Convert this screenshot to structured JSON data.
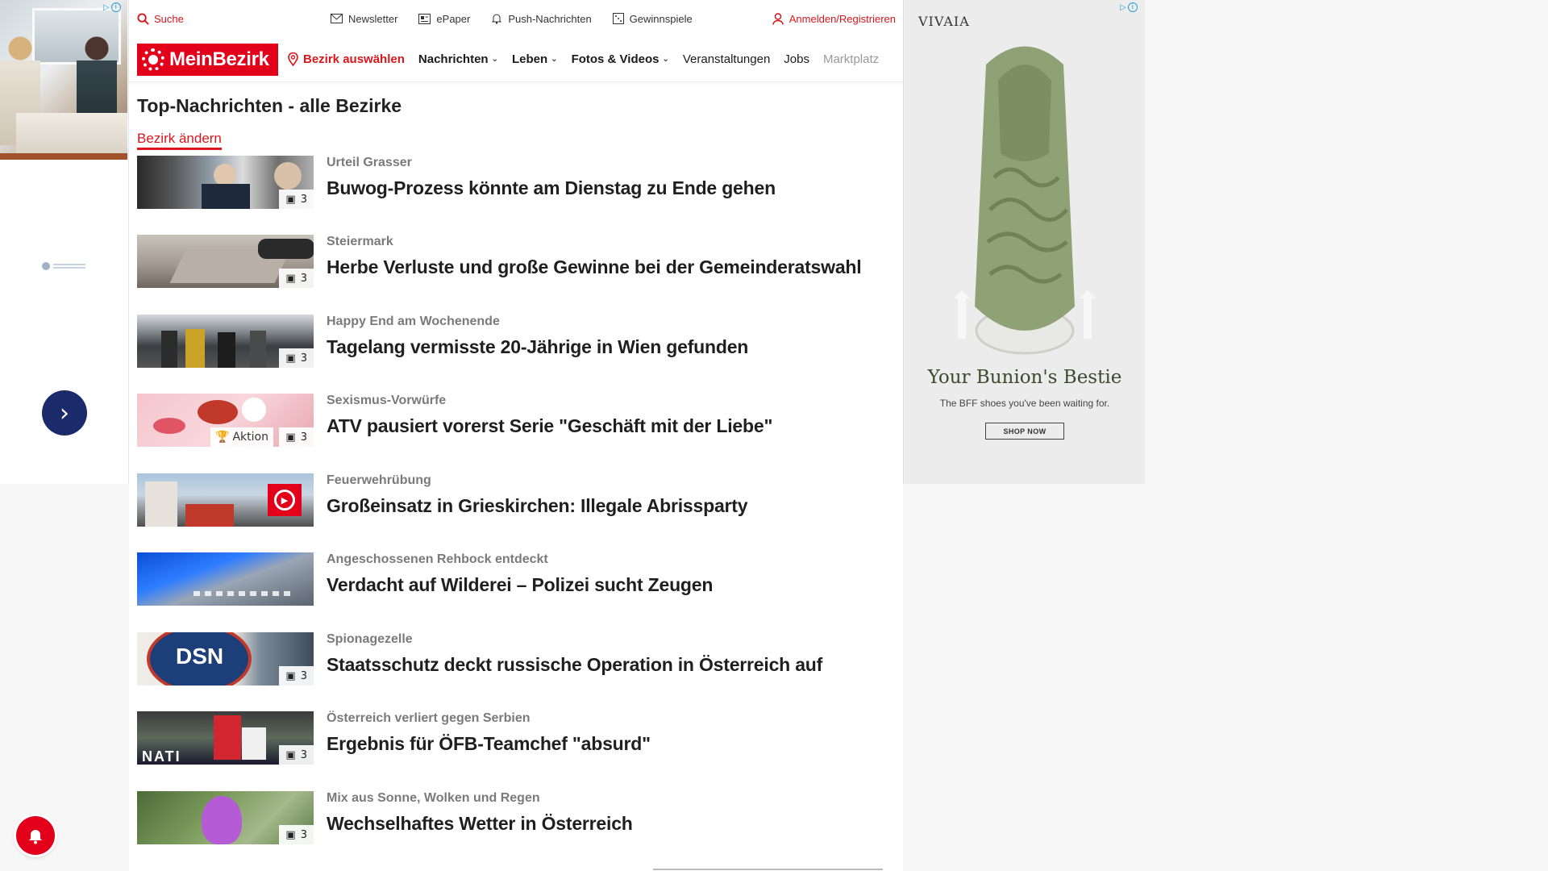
{
  "topbar": {
    "search_label": "Suche",
    "links": [
      {
        "label": "Newsletter",
        "icon": "envelope-icon"
      },
      {
        "label": "ePaper",
        "icon": "newspaper-icon"
      },
      {
        "label": "Push-Nachrichten",
        "icon": "bell-icon"
      },
      {
        "label": "Gewinnspiele",
        "icon": "gift-icon"
      }
    ],
    "login_label": "Anmelden/Registrieren"
  },
  "navbar": {
    "logo_text": "MeinBezirk",
    "select_district": "Bezirk auswählen",
    "items": [
      {
        "label": "Nachrichten",
        "has_dropdown": true
      },
      {
        "label": "Leben",
        "has_dropdown": true
      },
      {
        "label": "Fotos & Videos",
        "has_dropdown": true
      },
      {
        "label": "Veranstaltungen",
        "has_dropdown": false
      },
      {
        "label": "Jobs",
        "has_dropdown": false
      },
      {
        "label": "Marktplatz",
        "has_dropdown": false
      }
    ]
  },
  "main": {
    "title": "Top-Nachrichten - alle Bezirke",
    "change_district": "Bezirk ändern",
    "articles": [
      {
        "kicker": "Urteil Grasser",
        "headline": "Buwog-Prozess könnte am Dienstag zu Ende gehen",
        "photo_count": "3"
      },
      {
        "kicker": "Steiermark",
        "headline": "Herbe Verluste und große Gewinne bei der Gemeinderatswahl",
        "photo_count": "3"
      },
      {
        "kicker": "Happy End am Wochenende",
        "headline": "Tagelang vermisste 20-Jährige in Wien gefunden",
        "photo_count": "3"
      },
      {
        "kicker": "Sexismus-Vorwürfe",
        "headline": "ATV pausiert vorerst Serie \"Geschäft mit der Liebe\"",
        "photo_count": "3",
        "promo_label": "Aktion"
      },
      {
        "kicker": "Feuerwehrübung",
        "headline": "Großeinsatz in Grieskirchen: Illegale Abrissparty",
        "video": true
      },
      {
        "kicker": "Angeschossenen Rehbock entdeckt",
        "headline": "Verdacht auf Wilderei – Polizei sucht Zeugen"
      },
      {
        "kicker": "Spionagezelle",
        "headline": "Staatsschutz deckt russische Operation in Österreich auf",
        "photo_count": "3",
        "thumb_text": "DSN"
      },
      {
        "kicker": "Österreich verliert gegen Serbien",
        "headline": "Ergebnis für ÖFB-Teamchef \"absurd\"",
        "photo_count": "3",
        "thumb_text": "NATI"
      },
      {
        "kicker": "Mix aus Sonne, Wolken und Regen",
        "headline": "Wechselhaftes Wetter in Österreich",
        "photo_count": "3"
      }
    ]
  },
  "right_ad": {
    "brand": "VIVAIA",
    "headline": "Your Bunion's Bestie",
    "subline": "The BFF shoes you've been waiting for.",
    "cta": "SHOP NOW"
  },
  "colors": {
    "brand_red": "#e2001a",
    "ad_navy": "#1b2a6b",
    "shoe_green": "#8fa275"
  }
}
